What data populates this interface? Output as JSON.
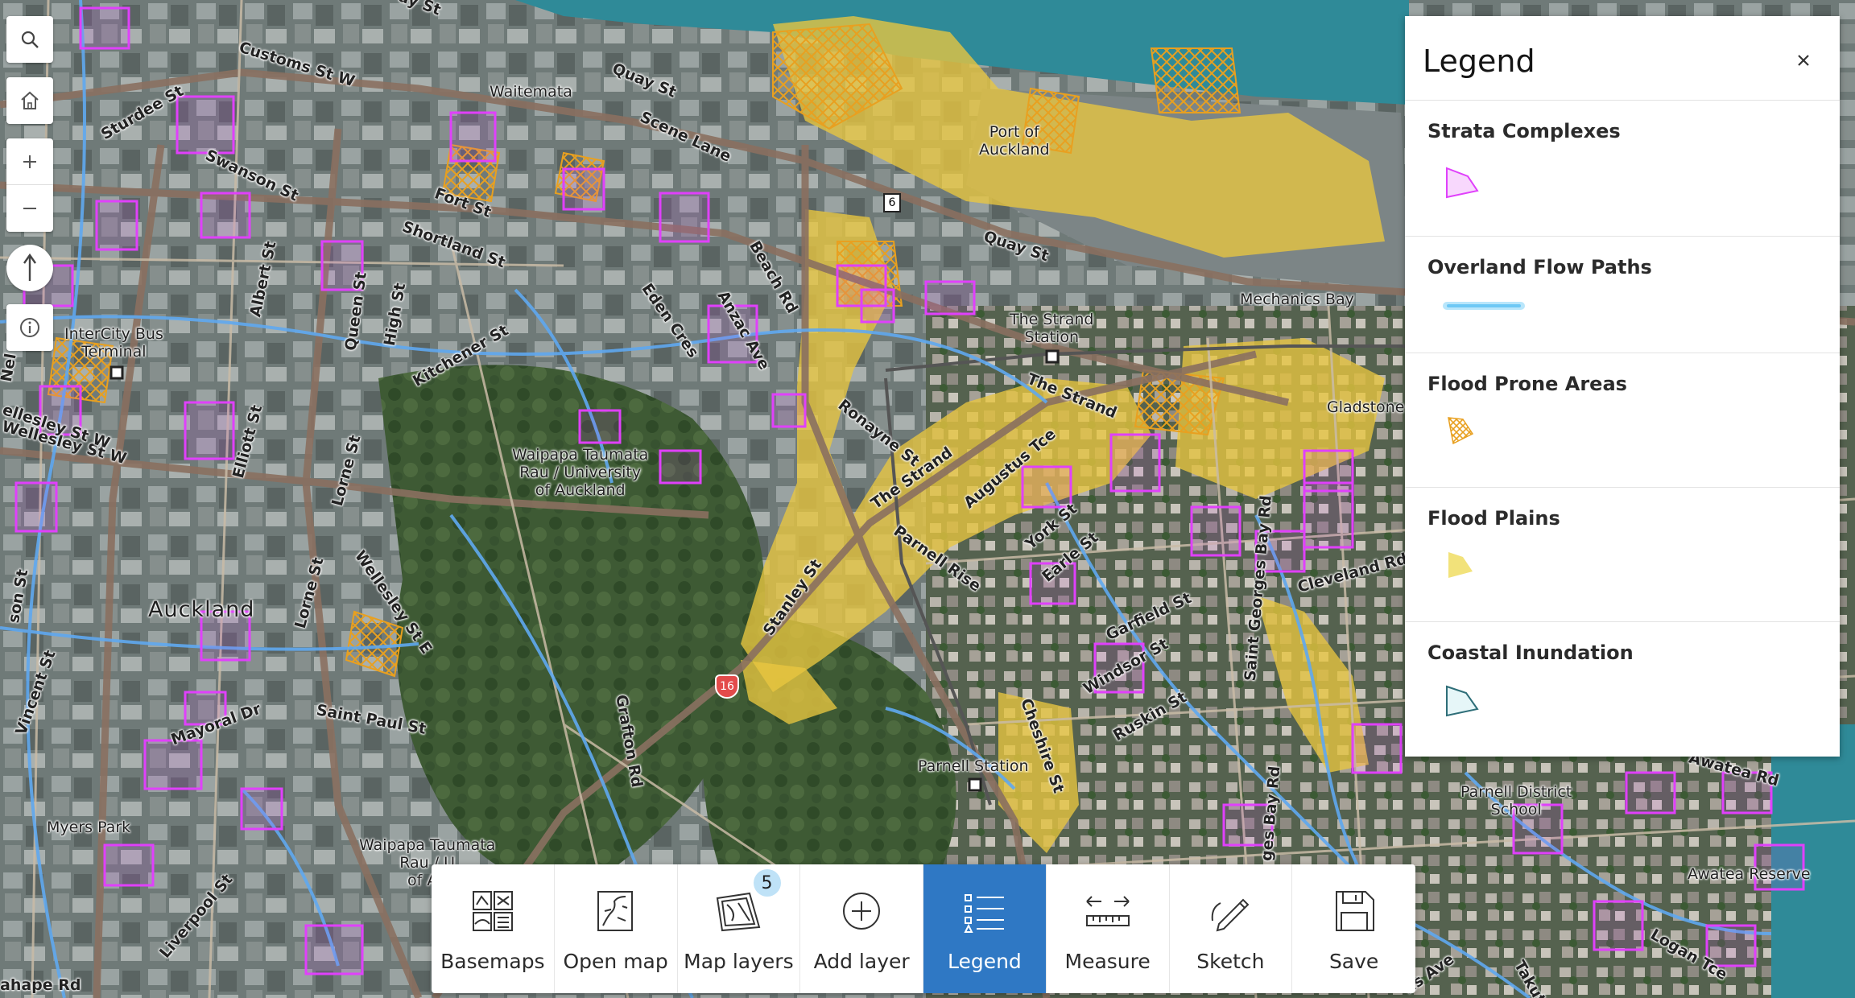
{
  "map": {
    "place_labels": [
      {
        "text": "Waitemata"
      },
      {
        "text": "Port of\nAuckland"
      },
      {
        "text": "Mechanics Bay"
      },
      {
        "text": "The Strand\nStation"
      },
      {
        "text": "Gladstone"
      },
      {
        "text": "InterCity Bus\nTerminal"
      },
      {
        "text": "Waipapa Taumata\nRau / University\nof Auckland"
      },
      {
        "text": "Auckland"
      },
      {
        "text": "Myers Park"
      },
      {
        "text": "Waipapa Taumata\nRau / U\nof Au"
      },
      {
        "text": "Parnell Station"
      },
      {
        "text": "Parnell District\nSchool"
      },
      {
        "text": "Awatea Reserve"
      }
    ],
    "street_labels": [
      {
        "text": "Customs St W"
      },
      {
        "text": "Sturdee St"
      },
      {
        "text": "Quay St"
      },
      {
        "text": "Scene Lane"
      },
      {
        "text": "Swanson St"
      },
      {
        "text": "Fort St"
      },
      {
        "text": "Shortland St"
      },
      {
        "text": "Beach Rd"
      },
      {
        "text": "Quay St"
      },
      {
        "text": "Albert St"
      },
      {
        "text": "Queen St"
      },
      {
        "text": "High St"
      },
      {
        "text": "Eden Cres"
      },
      {
        "text": "Anzac Ave"
      },
      {
        "text": "Kitchener St"
      },
      {
        "text": "The Strand"
      },
      {
        "text": "Ronayne St"
      },
      {
        "text": "The Strand"
      },
      {
        "text": "Augustus Tce"
      },
      {
        "text": "Elliott St"
      },
      {
        "text": "Lorne St"
      },
      {
        "text": "Wellesley St W"
      },
      {
        "text": "Wellesley St E"
      },
      {
        "text": "Lorne St"
      },
      {
        "text": "Parnell Rise"
      },
      {
        "text": "York St"
      },
      {
        "text": "Earle St"
      },
      {
        "text": "Stanley St"
      },
      {
        "text": "Saint Georges Bay Rd"
      },
      {
        "text": "Cleveland Rd"
      },
      {
        "text": "Garfield St"
      },
      {
        "text": "Windsor St"
      },
      {
        "text": "Ruskin St"
      },
      {
        "text": "Mayoral Dr"
      },
      {
        "text": "Saint Paul St"
      },
      {
        "text": "Grafton Rd"
      },
      {
        "text": "Cheshire St"
      },
      {
        "text": "Liverpool St"
      },
      {
        "text": "Awatea Rd"
      },
      {
        "text": "Logan Tce"
      },
      {
        "text": "ahape Rd"
      },
      {
        "text": "Vincent St"
      },
      {
        "text": "son St"
      },
      {
        "text": "Nel"
      },
      {
        "text": "ellesley St W"
      },
      {
        "text": "ges Bay Rd"
      },
      {
        "text": "ns Ave"
      },
      {
        "text": "Takut"
      },
      {
        "text": "ay St"
      }
    ],
    "route_shields": [
      {
        "text": "6"
      },
      {
        "text": "16"
      }
    ],
    "colors": {
      "strata": "#e040fb",
      "overland": "#5fa8f0",
      "flood_prone": "#e8a020",
      "flood_plain": "#f2d94a",
      "road": "#8a7060",
      "water": "#2f8a98"
    }
  },
  "nav": {
    "search_icon": "search-icon",
    "home_icon": "home-icon",
    "zoom_in_icon": "plus-icon",
    "zoom_out_icon": "minus-icon",
    "compass_icon": "north-arrow-icon",
    "info_icon": "info-icon"
  },
  "legend": {
    "title": "Legend",
    "close_icon": "close-icon",
    "items": [
      {
        "label": "Strata Complexes",
        "symbol": "polygon-outline-magenta",
        "color": "#e040fb"
      },
      {
        "label": "Overland Flow Paths",
        "symbol": "line-light-blue",
        "color": "#6ec8f5"
      },
      {
        "label": "Flood Prone Areas",
        "symbol": "hatch-orange",
        "color": "#e8a020"
      },
      {
        "label": "Flood Plains",
        "symbol": "polygon-fill-yellow",
        "color": "#f2e27a"
      },
      {
        "label": "Coastal Inundation",
        "symbol": "polygon-outline-teal",
        "color": "#2e6e78"
      }
    ]
  },
  "toolbar": {
    "items": [
      {
        "label": "Basemaps",
        "icon": "basemaps-icon"
      },
      {
        "label": "Open map",
        "icon": "open-map-icon"
      },
      {
        "label": "Map layers",
        "icon": "map-layers-icon",
        "badge": "5"
      },
      {
        "label": "Add layer",
        "icon": "add-layer-icon"
      },
      {
        "label": "Legend",
        "icon": "legend-icon",
        "active": true
      },
      {
        "label": "Measure",
        "icon": "measure-icon"
      },
      {
        "label": "Sketch",
        "icon": "sketch-icon"
      },
      {
        "label": "Save",
        "icon": "save-icon"
      }
    ]
  }
}
